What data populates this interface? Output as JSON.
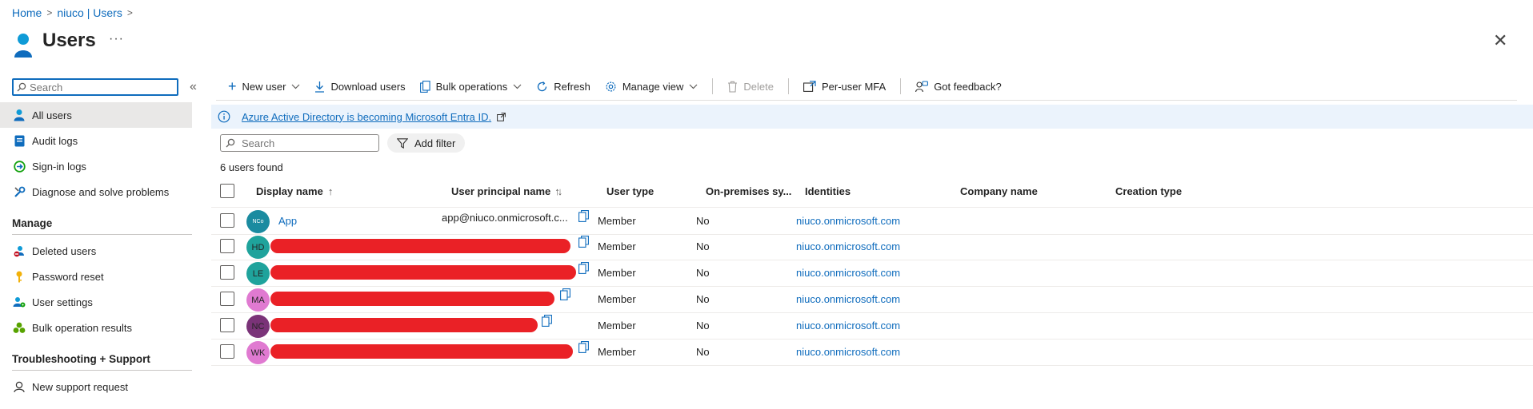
{
  "breadcrumb": {
    "home": "Home",
    "tenant": "niuco | Users"
  },
  "page": {
    "title": "Users",
    "more": "···"
  },
  "sidebar": {
    "search_placeholder": "Search",
    "items": [
      {
        "label": "All users",
        "icon": "user-icon"
      },
      {
        "label": "Audit logs",
        "icon": "audit-log-icon"
      },
      {
        "label": "Sign-in logs",
        "icon": "sign-in-icon"
      },
      {
        "label": "Diagnose and solve problems",
        "icon": "wrench-icon"
      }
    ],
    "manage_heading": "Manage",
    "manage_items": [
      {
        "label": "Deleted users",
        "icon": "deleted-user-icon"
      },
      {
        "label": "Password reset",
        "icon": "key-icon"
      },
      {
        "label": "User settings",
        "icon": "user-settings-icon"
      },
      {
        "label": "Bulk operation results",
        "icon": "bulk-results-icon"
      }
    ],
    "support_heading": "Troubleshooting + Support",
    "support_items": [
      {
        "label": "New support request",
        "icon": "support-person-icon"
      }
    ]
  },
  "toolbar": {
    "new_user": "New user",
    "download_users": "Download users",
    "bulk_operations": "Bulk operations",
    "refresh": "Refresh",
    "manage_view": "Manage view",
    "delete": "Delete",
    "per_user_mfa": "Per-user MFA",
    "feedback": "Got feedback?"
  },
  "banner": {
    "text": "Azure Active Directory is becoming Microsoft Entra ID."
  },
  "filter": {
    "search_placeholder": "Search",
    "add_filter": "Add filter"
  },
  "results": {
    "count_text": "6 users found"
  },
  "table": {
    "columns": [
      "Display name",
      "User principal name",
      "User type",
      "On-premises sy...",
      "Identities",
      "Company name",
      "Creation type"
    ],
    "sort_up": "↑",
    "sort_both": "↑↓",
    "rows": [
      {
        "initials": "NCo",
        "avatar_color": "#1b8ba0",
        "name": "App",
        "upn": "app@niuco.onmicrosoft.c...",
        "user_type": "Member",
        "on_prem": "No",
        "identities": "niuco.onmicrosoft.com",
        "redacted": false
      },
      {
        "initials": "HD",
        "avatar_color": "#1fa39c",
        "name": "",
        "upn": "",
        "user_type": "Member",
        "on_prem": "No",
        "identities": "niuco.onmicrosoft.com",
        "redacted": true
      },
      {
        "initials": "LE",
        "avatar_color": "#1fa39c",
        "name": "",
        "upn": "",
        "user_type": "Member",
        "on_prem": "No",
        "identities": "niuco.onmicrosoft.com",
        "redacted": true
      },
      {
        "initials": "MA",
        "avatar_color": "#e07ad1",
        "name": "",
        "upn": "",
        "user_type": "Member",
        "on_prem": "No",
        "identities": "niuco.onmicrosoft.com",
        "redacted": true
      },
      {
        "initials": "NC",
        "avatar_color": "#7a3378",
        "name": "",
        "upn": "",
        "user_type": "Member",
        "on_prem": "No",
        "identities": "niuco.onmicrosoft.com",
        "redacted": true
      },
      {
        "initials": "WK",
        "avatar_color": "#e07ad1",
        "name": "",
        "upn": "",
        "user_type": "Member",
        "on_prem": "No",
        "identities": "niuco.onmicrosoft.com",
        "redacted": true
      }
    ]
  },
  "colors": {
    "accent": "#0f6cbd",
    "redaction": "#ea2126",
    "banner_bg": "#ebf3fc"
  }
}
